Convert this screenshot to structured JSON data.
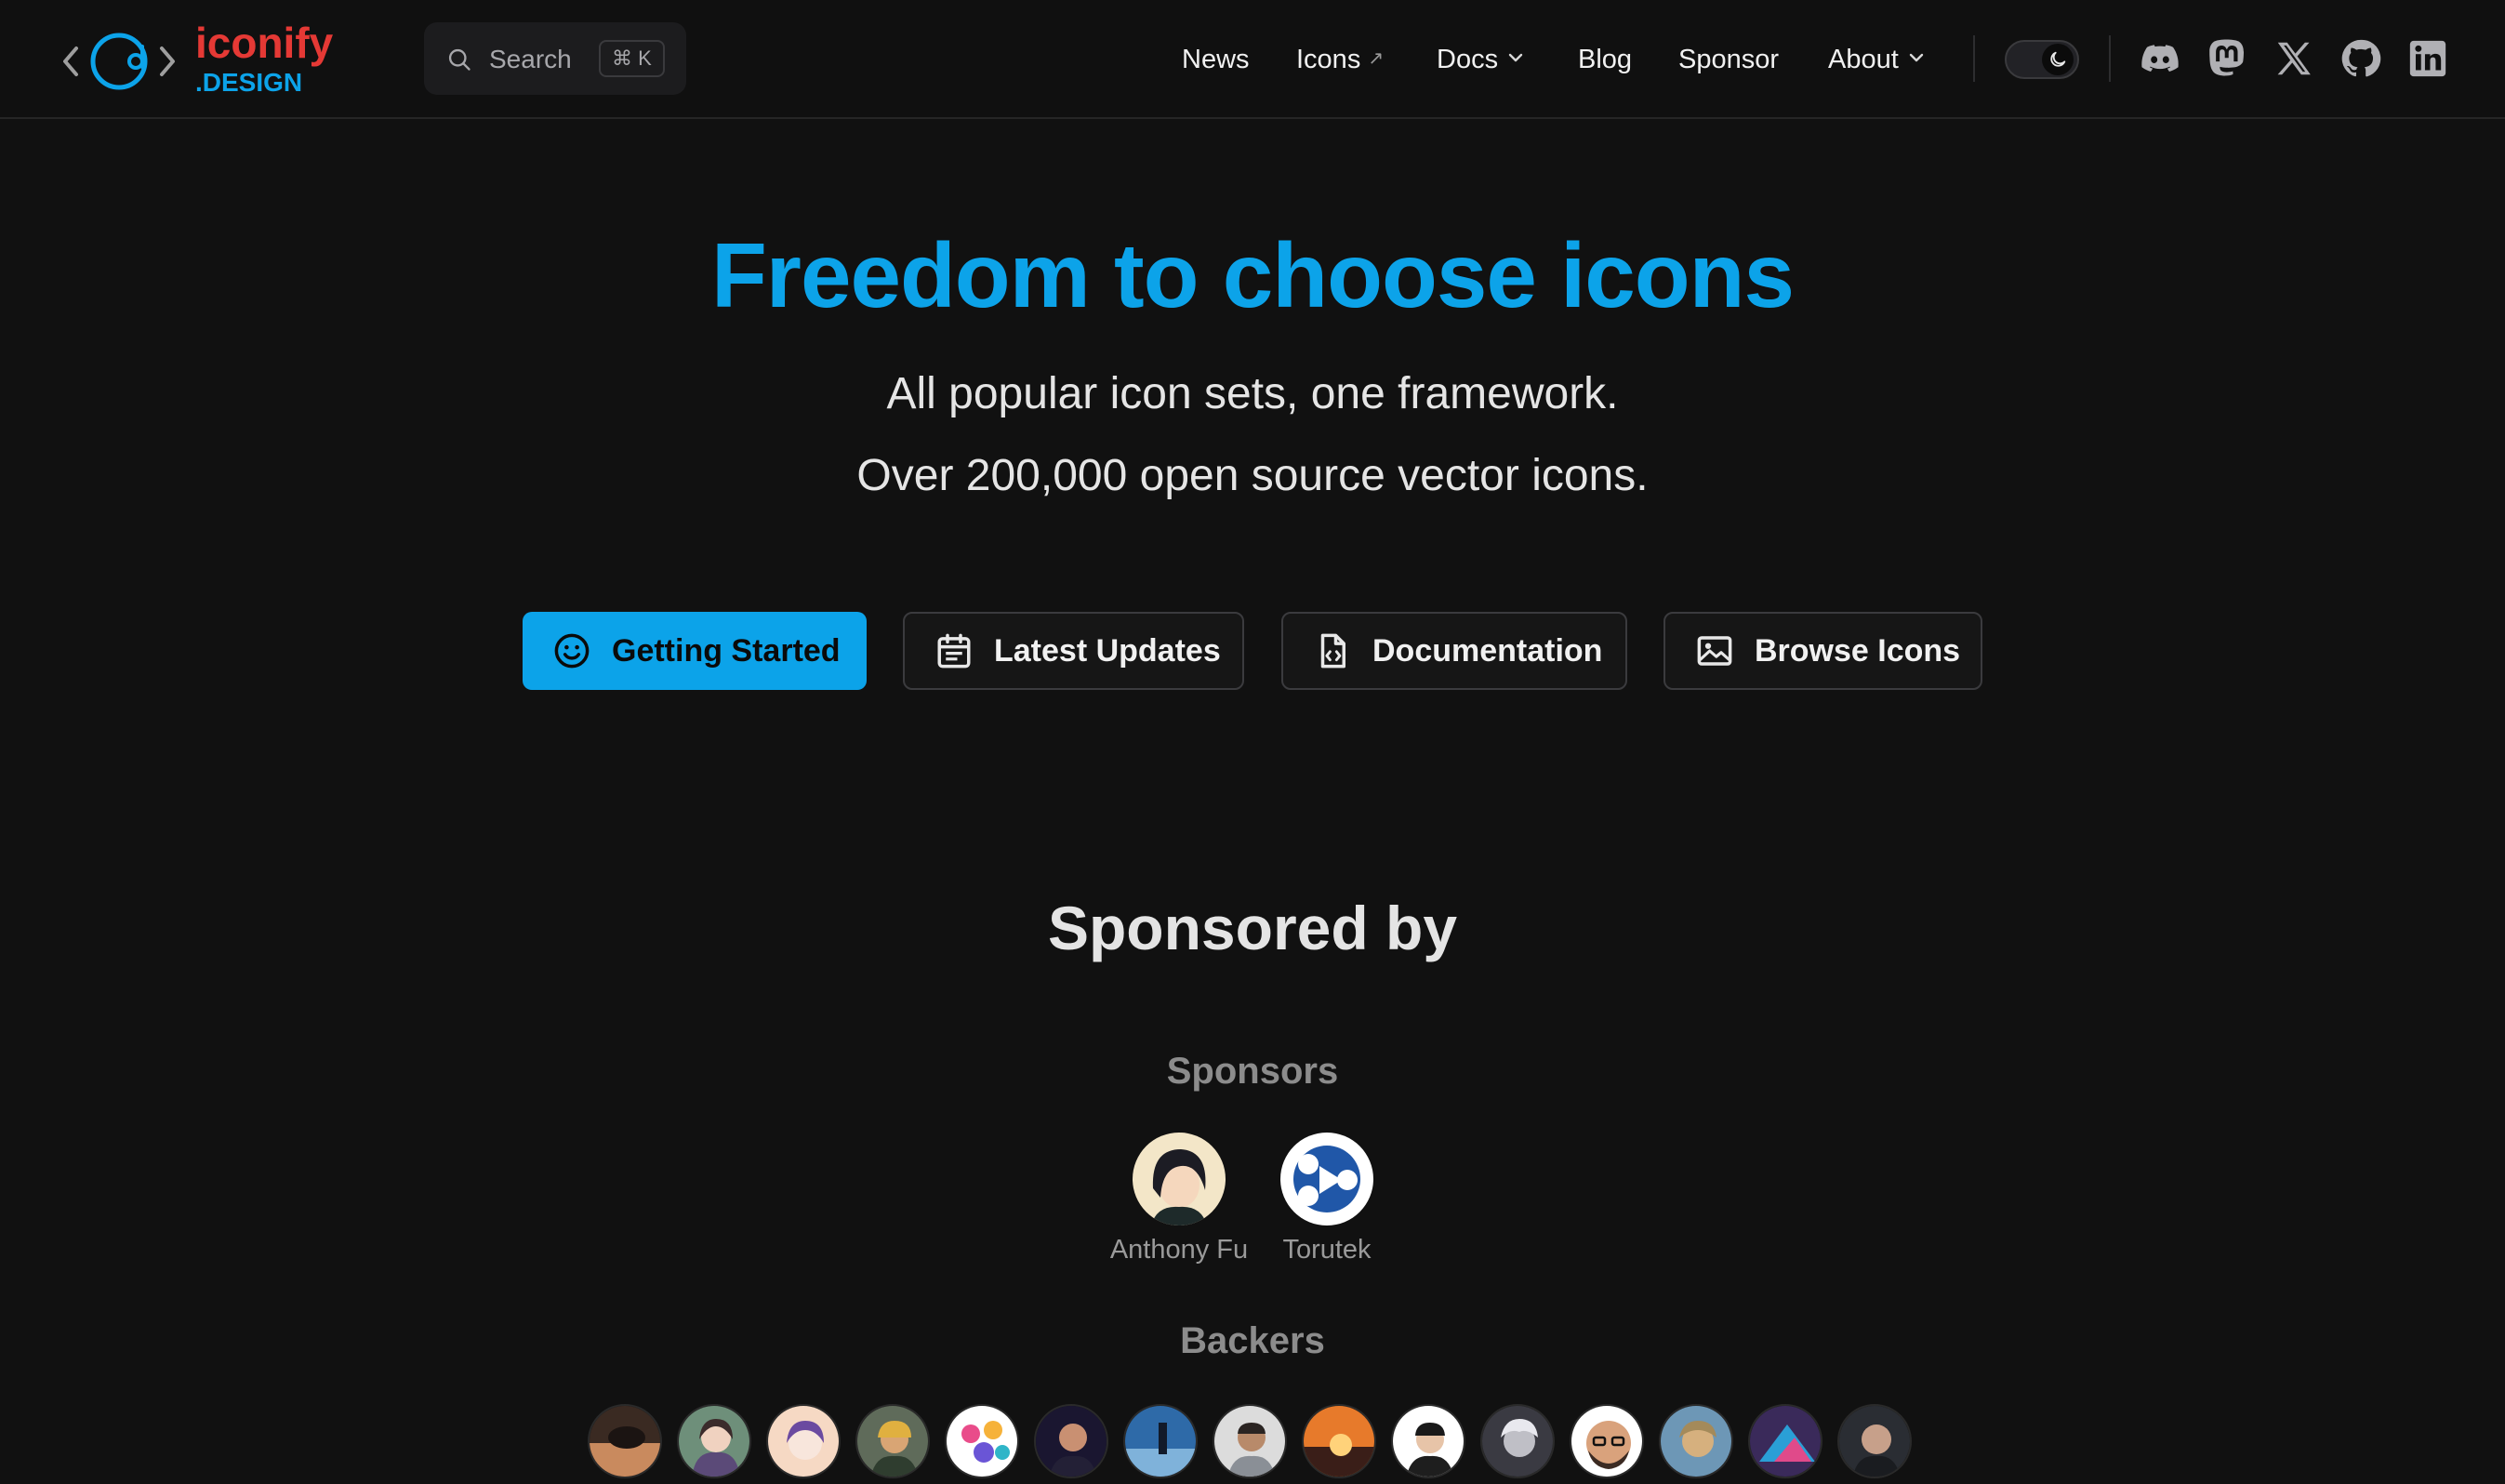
{
  "brand": {
    "name_top": "iconify",
    "name_bottom": ".DESIGN",
    "primary_color": "#0ca3e9",
    "logo_red": "#e53935",
    "logo_gray": "#9e9e9e"
  },
  "search": {
    "label": "Search",
    "shortcut": "⌘ K"
  },
  "nav": {
    "items": [
      {
        "label": "News"
      },
      {
        "label": "Icons",
        "suffix": "↗"
      },
      {
        "label": "Docs",
        "dropdown": true
      },
      {
        "label": "Blog"
      },
      {
        "label": "Sponsor"
      },
      {
        "label": "About",
        "dropdown": true
      }
    ],
    "social_icons": [
      "discord-icon",
      "mastodon-icon",
      "x-icon",
      "github-icon",
      "linkedin-icon"
    ],
    "theme": "dark"
  },
  "hero": {
    "title": "Freedom to choose icons",
    "subtitle_1": "All popular icon sets, one framework.",
    "subtitle_2": "Over 200,000 open source vector icons."
  },
  "actions": [
    {
      "label": "Getting Started",
      "icon": "smiley-icon",
      "style": "primary"
    },
    {
      "label": "Latest Updates",
      "icon": "calendar-icon",
      "style": "secondary"
    },
    {
      "label": "Documentation",
      "icon": "document-code-icon",
      "style": "secondary"
    },
    {
      "label": "Browse Icons",
      "icon": "image-icon",
      "style": "secondary"
    }
  ],
  "sponsorship": {
    "title": "Sponsored by",
    "sponsors_heading": "Sponsors",
    "sponsors": [
      {
        "name": "Anthony Fu"
      },
      {
        "name": "Torutek"
      }
    ],
    "backers_heading": "Backers",
    "backer_count": 15
  }
}
